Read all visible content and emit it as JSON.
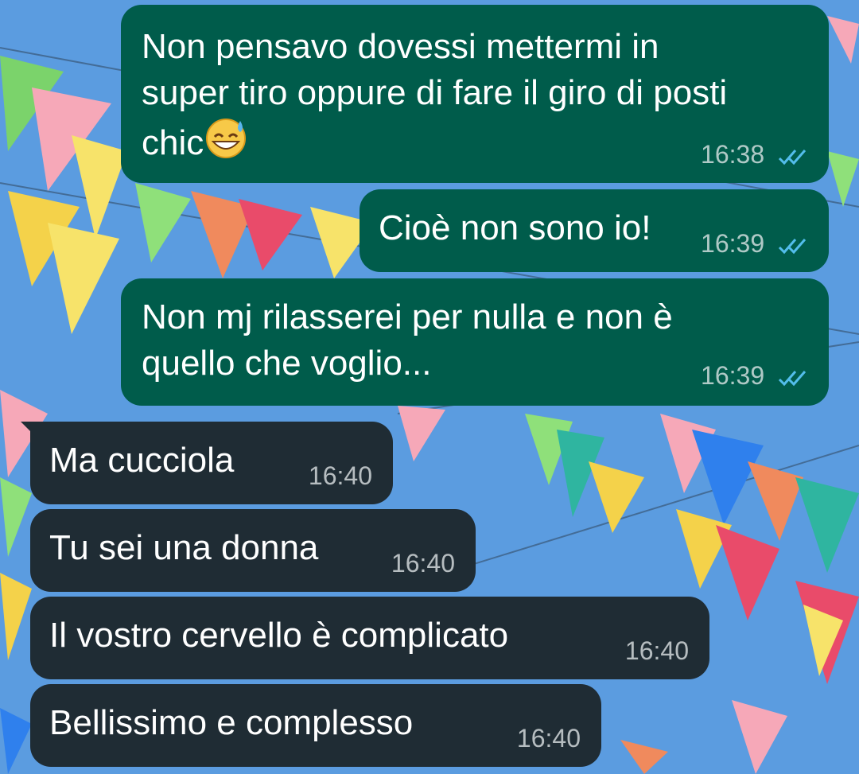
{
  "messages": [
    {
      "direction": "outgoing",
      "text": "Non pensavo dovessi mettermi in\nsuper tiro oppure di fare il giro di posti\nchic",
      "emoji": "grinning-face-with-sweat-icon",
      "time": "16:38",
      "status": "read"
    },
    {
      "direction": "outgoing",
      "text": "Cioè non sono io!",
      "time": "16:39",
      "status": "read"
    },
    {
      "direction": "outgoing",
      "text": "Non mj rilasserei per nulla e non è\nquello che voglio...",
      "time": "16:39",
      "status": "read"
    },
    {
      "direction": "incoming",
      "text": "Ma cucciola",
      "time": "16:40"
    },
    {
      "direction": "incoming",
      "text": "Tu sei una donna",
      "time": "16:40"
    },
    {
      "direction": "incoming",
      "text": "Il vostro cervello è complicato",
      "time": "16:40"
    },
    {
      "direction": "incoming",
      "text": "Bellissimo e complesso",
      "time": "16:40"
    }
  ],
  "colors": {
    "outgoing_bubble": "#005c4b",
    "incoming_bubble": "#1f2c34",
    "read_ticks": "#53bdeb",
    "timestamp": "#c9d1d5"
  }
}
